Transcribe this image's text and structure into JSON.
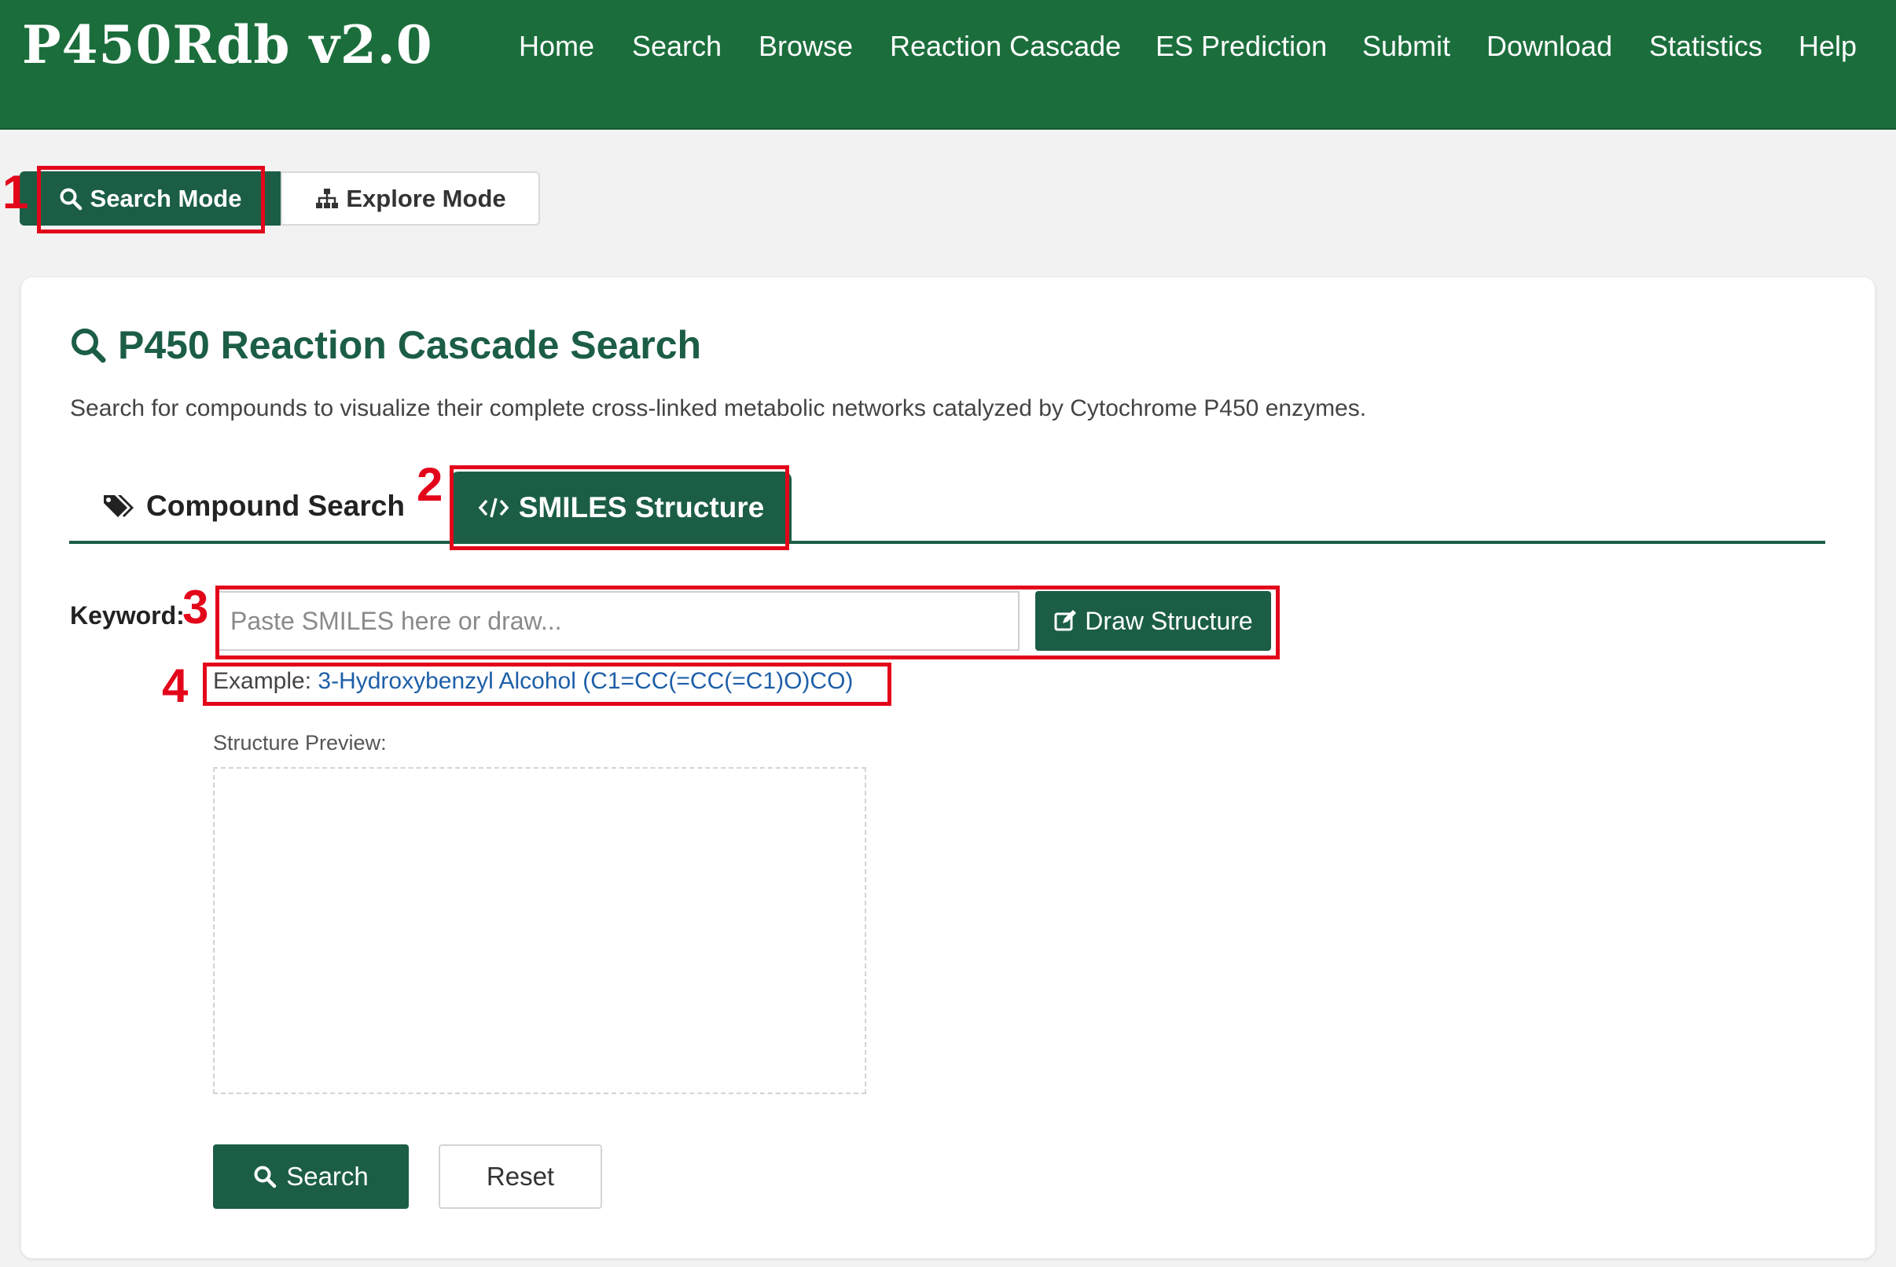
{
  "brand": "P450Rdb v2.0",
  "nav": {
    "items": [
      "Home",
      "Search",
      "Browse",
      "Reaction Cascade",
      "ES Prediction",
      "Submit",
      "Download",
      "Statistics",
      "Help"
    ]
  },
  "modes": {
    "search_label": "Search Mode",
    "explore_label": "Explore Mode",
    "active": "Search Mode"
  },
  "page": {
    "title": "P450 Reaction Cascade Search",
    "subtitle": "Search for compounds to visualize their complete cross-linked metabolic networks catalyzed by Cytochrome P450 enzymes."
  },
  "tabs": {
    "compound_label": "Compound Search",
    "smiles_label": "SMILES Structure",
    "active": "SMILES Structure"
  },
  "form": {
    "keyword_label": "Keyword:",
    "input_placeholder": "Paste SMILES here or draw...",
    "input_value": "",
    "draw_button": "Draw Structure",
    "example_prefix": "Example: ",
    "example_link": "3-Hydroxybenzyl Alcohol (C1=CC(=CC(=C1)O)CO)",
    "preview_label": "Structure Preview:",
    "search_button": "Search",
    "reset_button": "Reset"
  },
  "annotations": [
    "1",
    "2",
    "3",
    "4"
  ],
  "colors": {
    "navbar": "#1b6e3c",
    "primary": "#1b5e45",
    "annotation": "#e3061b",
    "link": "#1e5fa8",
    "background": "#f2f2f2"
  },
  "icons": {
    "search": "magnifier-icon",
    "explore": "sitemap-icon",
    "compound": "tags-icon",
    "smiles": "code-icon",
    "draw": "edit-icon"
  }
}
